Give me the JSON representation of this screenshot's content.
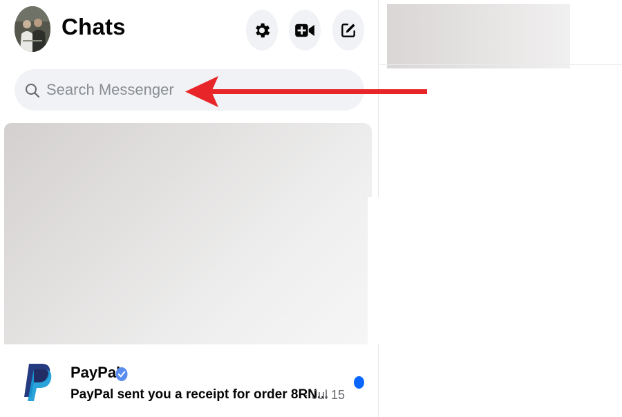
{
  "header": {
    "title": "Chats",
    "avatar_icon": "user-avatar-photo",
    "settings_icon": "gear-icon",
    "video_call_icon": "video-add-icon",
    "new_message_icon": "compose-icon"
  },
  "search": {
    "placeholder": "Search Messenger",
    "icon": "search-icon"
  },
  "chats": [
    {
      "name": "PayPal",
      "verified": true,
      "preview": "PayPal sent you a receipt for order 8RN...",
      "time": "· Jul 15",
      "unread": true,
      "logo_icon": "paypal-logo"
    }
  ],
  "annotation": {
    "color": "#e8262a",
    "points_to": "search-input"
  },
  "colors": {
    "accent": "#0866ff",
    "verified": "#5b8def",
    "search_bg": "#f0f2f5"
  }
}
